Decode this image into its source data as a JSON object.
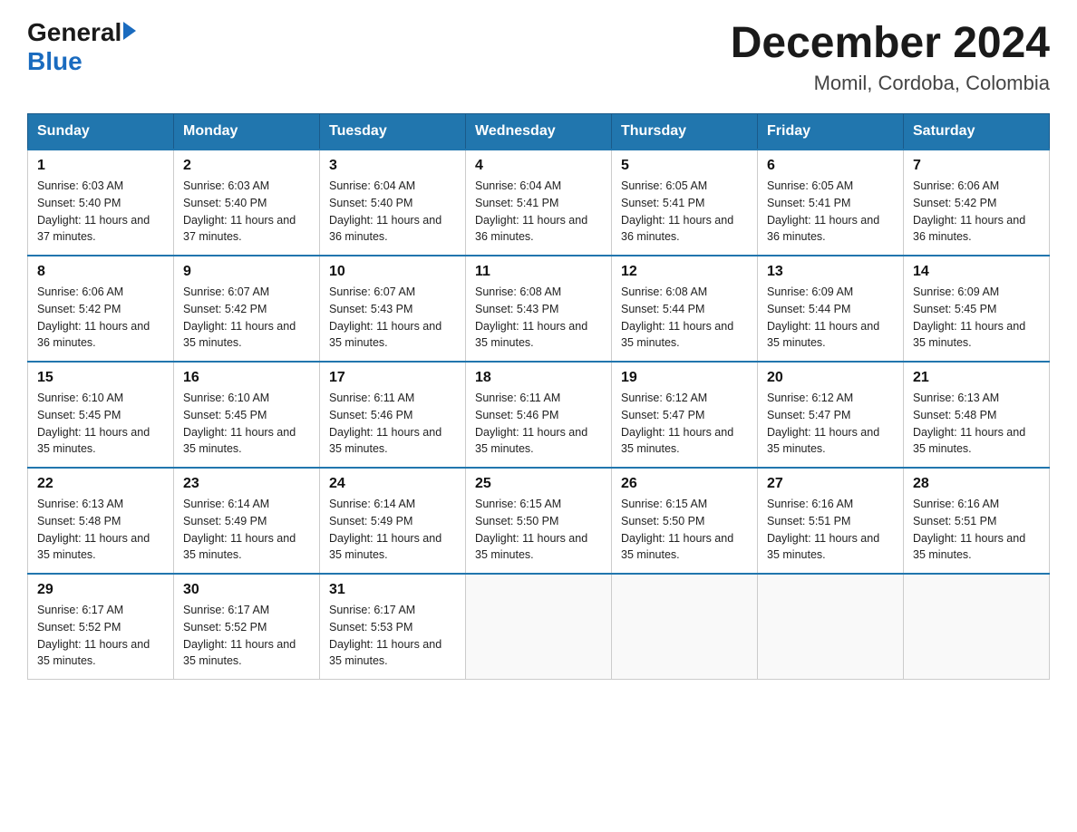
{
  "header": {
    "logo_general": "General",
    "logo_blue": "Blue",
    "title": "December 2024",
    "location": "Momil, Cordoba, Colombia"
  },
  "days_of_week": [
    "Sunday",
    "Monday",
    "Tuesday",
    "Wednesday",
    "Thursday",
    "Friday",
    "Saturday"
  ],
  "weeks": [
    [
      {
        "num": "1",
        "sunrise": "6:03 AM",
        "sunset": "5:40 PM",
        "daylight": "11 hours and 37 minutes."
      },
      {
        "num": "2",
        "sunrise": "6:03 AM",
        "sunset": "5:40 PM",
        "daylight": "11 hours and 37 minutes."
      },
      {
        "num": "3",
        "sunrise": "6:04 AM",
        "sunset": "5:40 PM",
        "daylight": "11 hours and 36 minutes."
      },
      {
        "num": "4",
        "sunrise": "6:04 AM",
        "sunset": "5:41 PM",
        "daylight": "11 hours and 36 minutes."
      },
      {
        "num": "5",
        "sunrise": "6:05 AM",
        "sunset": "5:41 PM",
        "daylight": "11 hours and 36 minutes."
      },
      {
        "num": "6",
        "sunrise": "6:05 AM",
        "sunset": "5:41 PM",
        "daylight": "11 hours and 36 minutes."
      },
      {
        "num": "7",
        "sunrise": "6:06 AM",
        "sunset": "5:42 PM",
        "daylight": "11 hours and 36 minutes."
      }
    ],
    [
      {
        "num": "8",
        "sunrise": "6:06 AM",
        "sunset": "5:42 PM",
        "daylight": "11 hours and 36 minutes."
      },
      {
        "num": "9",
        "sunrise": "6:07 AM",
        "sunset": "5:42 PM",
        "daylight": "11 hours and 35 minutes."
      },
      {
        "num": "10",
        "sunrise": "6:07 AM",
        "sunset": "5:43 PM",
        "daylight": "11 hours and 35 minutes."
      },
      {
        "num": "11",
        "sunrise": "6:08 AM",
        "sunset": "5:43 PM",
        "daylight": "11 hours and 35 minutes."
      },
      {
        "num": "12",
        "sunrise": "6:08 AM",
        "sunset": "5:44 PM",
        "daylight": "11 hours and 35 minutes."
      },
      {
        "num": "13",
        "sunrise": "6:09 AM",
        "sunset": "5:44 PM",
        "daylight": "11 hours and 35 minutes."
      },
      {
        "num": "14",
        "sunrise": "6:09 AM",
        "sunset": "5:45 PM",
        "daylight": "11 hours and 35 minutes."
      }
    ],
    [
      {
        "num": "15",
        "sunrise": "6:10 AM",
        "sunset": "5:45 PM",
        "daylight": "11 hours and 35 minutes."
      },
      {
        "num": "16",
        "sunrise": "6:10 AM",
        "sunset": "5:45 PM",
        "daylight": "11 hours and 35 minutes."
      },
      {
        "num": "17",
        "sunrise": "6:11 AM",
        "sunset": "5:46 PM",
        "daylight": "11 hours and 35 minutes."
      },
      {
        "num": "18",
        "sunrise": "6:11 AM",
        "sunset": "5:46 PM",
        "daylight": "11 hours and 35 minutes."
      },
      {
        "num": "19",
        "sunrise": "6:12 AM",
        "sunset": "5:47 PM",
        "daylight": "11 hours and 35 minutes."
      },
      {
        "num": "20",
        "sunrise": "6:12 AM",
        "sunset": "5:47 PM",
        "daylight": "11 hours and 35 minutes."
      },
      {
        "num": "21",
        "sunrise": "6:13 AM",
        "sunset": "5:48 PM",
        "daylight": "11 hours and 35 minutes."
      }
    ],
    [
      {
        "num": "22",
        "sunrise": "6:13 AM",
        "sunset": "5:48 PM",
        "daylight": "11 hours and 35 minutes."
      },
      {
        "num": "23",
        "sunrise": "6:14 AM",
        "sunset": "5:49 PM",
        "daylight": "11 hours and 35 minutes."
      },
      {
        "num": "24",
        "sunrise": "6:14 AM",
        "sunset": "5:49 PM",
        "daylight": "11 hours and 35 minutes."
      },
      {
        "num": "25",
        "sunrise": "6:15 AM",
        "sunset": "5:50 PM",
        "daylight": "11 hours and 35 minutes."
      },
      {
        "num": "26",
        "sunrise": "6:15 AM",
        "sunset": "5:50 PM",
        "daylight": "11 hours and 35 minutes."
      },
      {
        "num": "27",
        "sunrise": "6:16 AM",
        "sunset": "5:51 PM",
        "daylight": "11 hours and 35 minutes."
      },
      {
        "num": "28",
        "sunrise": "6:16 AM",
        "sunset": "5:51 PM",
        "daylight": "11 hours and 35 minutes."
      }
    ],
    [
      {
        "num": "29",
        "sunrise": "6:17 AM",
        "sunset": "5:52 PM",
        "daylight": "11 hours and 35 minutes."
      },
      {
        "num": "30",
        "sunrise": "6:17 AM",
        "sunset": "5:52 PM",
        "daylight": "11 hours and 35 minutes."
      },
      {
        "num": "31",
        "sunrise": "6:17 AM",
        "sunset": "5:53 PM",
        "daylight": "11 hours and 35 minutes."
      },
      null,
      null,
      null,
      null
    ]
  ]
}
